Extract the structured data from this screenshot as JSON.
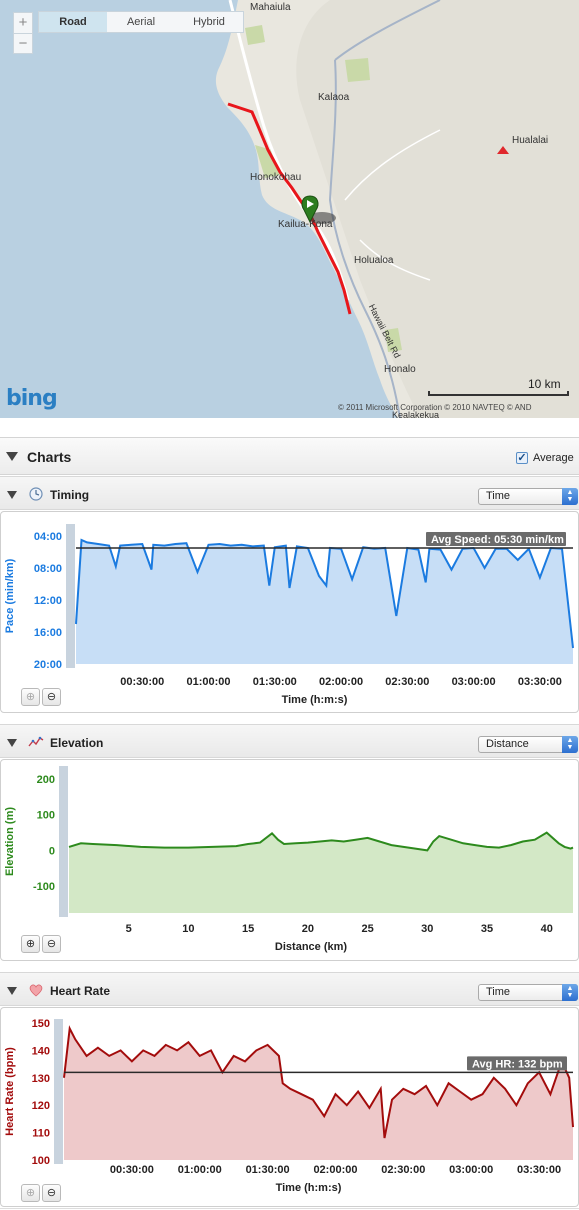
{
  "map": {
    "types": [
      "Road",
      "Aerial",
      "Hybrid"
    ],
    "active_type": "Road",
    "zoom_in": "+",
    "zoom_out": "−",
    "towns": [
      {
        "name": "Mahaiula",
        "key": "mahaiula"
      },
      {
        "name": "Kalaoa",
        "key": "kalaoa"
      },
      {
        "name": "Hualalai",
        "key": "hualalai"
      },
      {
        "name": "Honokohau",
        "key": "honokohau"
      },
      {
        "name": "Kailua-Kona",
        "key": "kailua-kona"
      },
      {
        "name": "Holualoa",
        "key": "holualoa"
      },
      {
        "name": "Hawaii Belt Rd",
        "key": "hawaii-belt-rd"
      },
      {
        "name": "Honalo",
        "key": "honalo"
      },
      {
        "name": "Kealakekua",
        "key": "kealakekua"
      }
    ],
    "logo": "bing",
    "scale": "10 km",
    "copyright": "© 2011 Microsoft Corporation   © 2010 NAVTEQ   © AND",
    "route_color": "#e8161b"
  },
  "charts_section": {
    "title": "Charts",
    "average_label": "Average",
    "average_checked": true
  },
  "panels": {
    "timing": {
      "title": "Timing",
      "icon": "clock-icon",
      "select": "Time",
      "ylabel": "Pace (min/km)",
      "xlabel": "Time (h:m:s)",
      "avg_label": "Avg Speed: 05:30 min/km",
      "color": "#1b7be0"
    },
    "elevation": {
      "title": "Elevation",
      "icon": "elevation-icon",
      "select": "Distance",
      "ylabel": "Elevation (m)",
      "xlabel": "Distance (km)",
      "color": "#2d8a1d"
    },
    "heartrate": {
      "title": "Heart Rate",
      "icon": "heart-icon",
      "select": "Time",
      "ylabel": "Heart Rate (bpm)",
      "xlabel": "Time (h:m:s)",
      "avg_label": "Avg HR: 132 bpm",
      "color": "#a30c0c"
    }
  },
  "chart_data": [
    {
      "type": "area",
      "title": "",
      "xlabel": "Time (h:m:s)",
      "ylabel": "Pace (min/km)",
      "x_unit": "seconds",
      "x_ticks": [
        "00:30:00",
        "01:00:00",
        "01:30:00",
        "02:00:00",
        "02:30:00",
        "03:00:00",
        "03:30:00"
      ],
      "y_ticks": [
        "04:00",
        "08:00",
        "12:00",
        "16:00",
        "20:00"
      ],
      "y_inverted": true,
      "ylim_minutes": [
        3,
        20
      ],
      "xlim_seconds": [
        0,
        13500
      ],
      "average_minutes": 5.5,
      "series": [
        {
          "x": [
            0,
            150,
            300,
            600,
            900,
            1080,
            1200,
            1500,
            1800,
            2050,
            2100,
            2400,
            2700,
            3000,
            3300,
            3600,
            3900,
            4200,
            4500,
            4800,
            5100,
            5250,
            5400,
            5700,
            5800,
            6000,
            6300,
            6600,
            6800,
            6900,
            7200,
            7500,
            7800,
            8100,
            8400,
            8700,
            9000,
            9300,
            9500,
            9600,
            9900,
            10200,
            10500,
            10800,
            11100,
            11400,
            11700,
            12000,
            12300,
            12600,
            12900,
            13200,
            13500
          ],
          "y": [
            15,
            4.5,
            4.8,
            5,
            5.2,
            7.8,
            5.2,
            5.1,
            5.0,
            8.2,
            5.1,
            5.2,
            5.0,
            4.9,
            8.5,
            5.1,
            5.0,
            5.2,
            5.1,
            5.3,
            5.2,
            10.2,
            5.4,
            5.2,
            10.5,
            5.3,
            5.5,
            9.0,
            10.2,
            5.5,
            5.6,
            9.4,
            5.4,
            5.6,
            5.5,
            14.0,
            5.5,
            5.7,
            9.8,
            5.6,
            5.7,
            8.2,
            5.6,
            5.5,
            8.0,
            5.6,
            5.6,
            7.0,
            5.6,
            9.2,
            5.5,
            5.6,
            18
          ]
        }
      ]
    },
    {
      "type": "area",
      "title": "",
      "xlabel": "Distance (km)",
      "ylabel": "Elevation (m)",
      "x_ticks": [
        "5",
        "10",
        "15",
        "20",
        "25",
        "30",
        "35",
        "40"
      ],
      "y_ticks": [
        "200",
        "100",
        "0",
        "-100"
      ],
      "ylim": [
        -175,
        225
      ],
      "xlim": [
        0,
        42.2
      ],
      "series": [
        {
          "x": [
            0,
            1,
            2,
            4,
            6,
            8,
            10,
            12,
            14,
            15,
            16,
            17,
            17.5,
            18,
            19,
            20,
            21,
            22,
            23,
            24,
            25,
            26,
            27,
            28,
            29,
            30,
            30.5,
            31,
            32,
            33,
            34,
            35,
            36,
            37,
            38,
            39,
            40,
            41,
            41.5,
            42,
            42.2
          ],
          "y": [
            10,
            20,
            18,
            15,
            10,
            8,
            8,
            10,
            12,
            18,
            22,
            48,
            30,
            18,
            20,
            22,
            25,
            28,
            25,
            30,
            35,
            25,
            15,
            10,
            5,
            0,
            25,
            40,
            30,
            20,
            15,
            10,
            8,
            15,
            25,
            30,
            50,
            20,
            10,
            5,
            8
          ]
        }
      ]
    },
    {
      "type": "area",
      "title": "",
      "xlabel": "Time (h:m:s)",
      "ylabel": "Heart Rate (bpm)",
      "x_ticks": [
        "00:30:00",
        "01:00:00",
        "01:30:00",
        "02:00:00",
        "02:30:00",
        "03:00:00",
        "03:30:00"
      ],
      "y_ticks": [
        "150",
        "140",
        "130",
        "120",
        "110",
        "100"
      ],
      "ylim": [
        100,
        150
      ],
      "xlim_seconds": [
        0,
        13500
      ],
      "average": 132,
      "series": [
        {
          "x": [
            0,
            150,
            300,
            600,
            900,
            1200,
            1500,
            1800,
            2100,
            2400,
            2700,
            3000,
            3300,
            3600,
            3900,
            4200,
            4500,
            4800,
            5100,
            5400,
            5700,
            5800,
            6000,
            6300,
            6600,
            6800,
            6900,
            7200,
            7500,
            7800,
            8100,
            8400,
            8500,
            8700,
            9000,
            9300,
            9600,
            9900,
            10200,
            10500,
            10800,
            11100,
            11400,
            11700,
            12000,
            12300,
            12600,
            12900,
            13200,
            13400,
            13500
          ],
          "y": [
            130,
            148,
            144,
            138,
            141,
            138,
            140,
            136,
            140,
            138,
            142,
            140,
            143,
            138,
            140,
            132,
            138,
            136,
            140,
            142,
            138,
            128,
            126,
            124,
            122,
            118,
            116,
            124,
            120,
            125,
            119,
            126,
            108,
            122,
            126,
            124,
            127,
            120,
            128,
            125,
            122,
            124,
            130,
            126,
            120,
            128,
            132,
            124,
            136,
            130,
            112
          ]
        }
      ]
    }
  ]
}
